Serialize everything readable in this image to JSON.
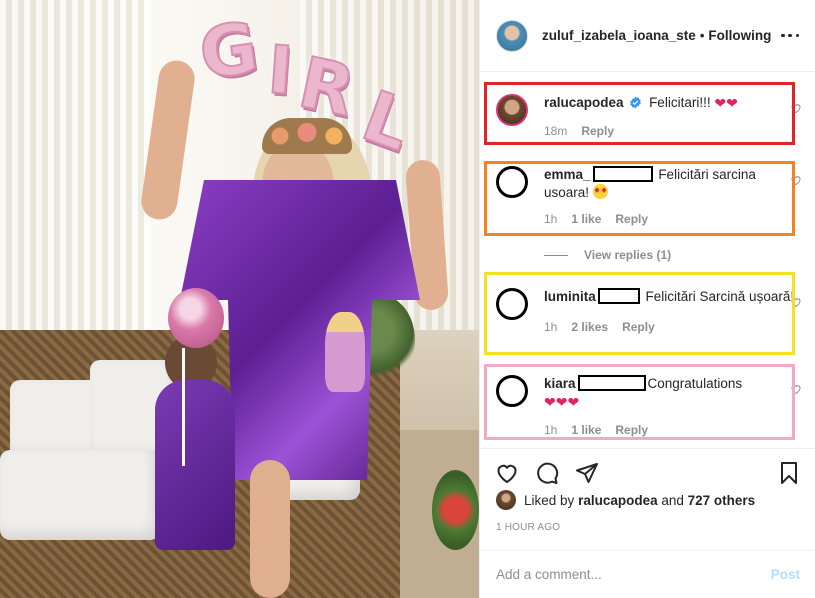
{
  "header": {
    "username": "zuluf_izabela_ioana_ste",
    "separator": "•",
    "follow_status": "Following"
  },
  "photo": {
    "balloon_letters": [
      "G",
      "I",
      "R",
      "L"
    ]
  },
  "comments": [
    {
      "username": "ralucapodea",
      "verified": true,
      "text": "Felicitari!!!",
      "emoji": "❤❤",
      "time": "18m",
      "likes": "",
      "reply": "Reply"
    },
    {
      "username": "emma_",
      "text": "Felicitări sarcina usoara!",
      "time": "1h",
      "likes": "1 like",
      "reply": "Reply"
    },
    {
      "username": "luminita",
      "text": "Felicitări Sarcină ușoară!",
      "time": "1h",
      "likes": "2 likes",
      "reply": "Reply"
    },
    {
      "username": "kiara",
      "text": "Congratulations",
      "emoji": "❤❤❤",
      "time": "1h",
      "likes": "1 like",
      "reply": "Reply"
    }
  ],
  "view_replies": "View replies (1)",
  "likes": {
    "prefix": "Liked by",
    "user": "ralucapodea",
    "connector": "and",
    "others": "727 others"
  },
  "time_ago": "1 HOUR AGO",
  "add_comment": {
    "placeholder": "Add a comment...",
    "post_label": "Post"
  },
  "highlight_colors": {
    "red": "#e0242a",
    "orange": "#f58220",
    "yellow": "#f4e220",
    "pink": "#f2a9c6"
  }
}
